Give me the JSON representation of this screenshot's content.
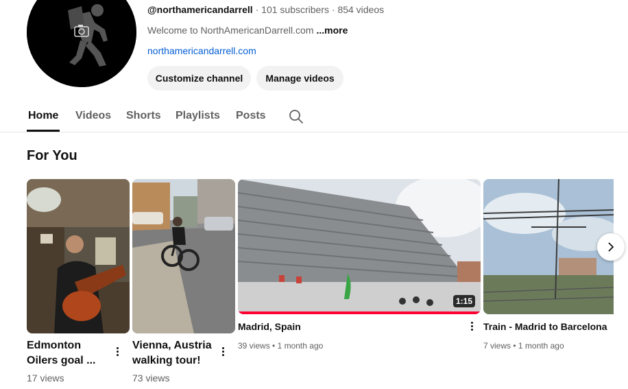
{
  "channel": {
    "handle": "@northamericandarrell",
    "subscribers": "101 subscribers",
    "videos_count": "854 videos",
    "separator": "·",
    "description": "Welcome to NorthAmericanDarrell.com",
    "more_label": "...more",
    "link": "northamericandarrell.com",
    "avatar_icon": "hiker-icon",
    "camera_icon": "camera-icon"
  },
  "actions": {
    "customize_label": "Customize channel",
    "manage_label": "Manage videos"
  },
  "tabs": [
    {
      "label": "Home",
      "active": true
    },
    {
      "label": "Videos",
      "active": false
    },
    {
      "label": "Shorts",
      "active": false
    },
    {
      "label": "Playlists",
      "active": false
    },
    {
      "label": "Posts",
      "active": false
    }
  ],
  "section": {
    "title": "For You"
  },
  "items": [
    {
      "title_line1": "Edmonton",
      "title_line2": "Oilers goal ...",
      "views": "17 views"
    },
    {
      "title_line1": "Vienna, Austria",
      "title_line2": "walking tour!",
      "views": "73 views"
    },
    {
      "title": "Madrid, Spain",
      "views": "39 views",
      "age": "1 month ago",
      "duration": "1:15",
      "watched_fraction": 1.0
    },
    {
      "title": "Train - Madrid to Barcelona",
      "views": "7 views",
      "age": "1 month ago"
    }
  ],
  "meta_separator": "•",
  "colors": {
    "link": "#065fd4",
    "progress": "#ff0033",
    "button_bg": "#f2f2f2"
  }
}
